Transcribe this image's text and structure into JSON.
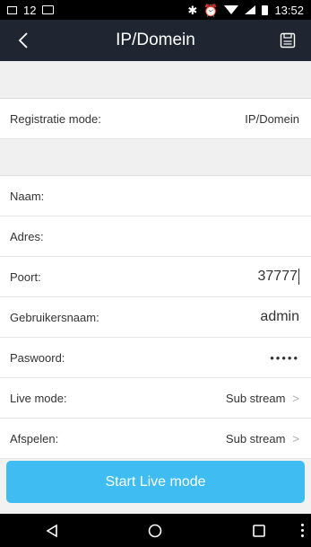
{
  "status_bar": {
    "left_text": "12",
    "time": "13:52"
  },
  "header": {
    "title": "IP/Domein",
    "back_icon": "chevron-left-icon",
    "save_icon": "save-icon"
  },
  "registration": {
    "label": "Registratie mode:",
    "value": "IP/Domein"
  },
  "fields": {
    "naam": {
      "label": "Naam:",
      "value": ""
    },
    "adres": {
      "label": "Adres:",
      "value": ""
    },
    "poort": {
      "label": "Poort:",
      "value": "37777"
    },
    "gebruikersnaam": {
      "label": "Gebruikersnaam:",
      "value": "admin"
    },
    "paswoord": {
      "label": "Paswoord:",
      "value": "•••••"
    },
    "live_mode": {
      "label": "Live mode:",
      "value": "Sub stream"
    },
    "afspelen": {
      "label": "Afspelen:",
      "value": "Sub stream"
    }
  },
  "chevron": ">",
  "button": {
    "label": "Start Live mode"
  },
  "colors": {
    "accent": "#3fbdf2",
    "titlebar": "#202631"
  }
}
